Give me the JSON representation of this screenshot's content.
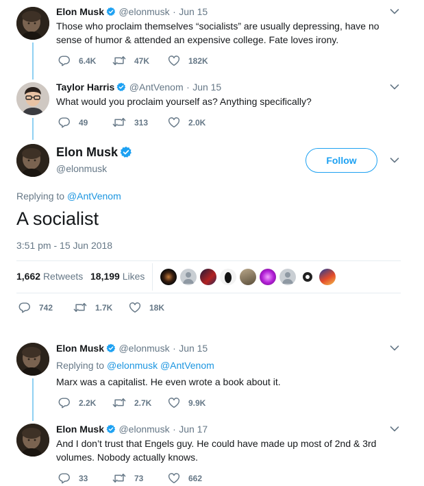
{
  "tweets_above": [
    {
      "name": "Elon Musk",
      "handle": "@elonmusk",
      "dot": "·",
      "date": "Jun 15",
      "text": "Those who proclaim themselves “socialists” are usually depressing, have no sense of humor & attended an expensive college. Fate loves irony.",
      "replies": "6.4K",
      "retweets": "47K",
      "likes": "182K"
    },
    {
      "name": "Taylor Harris",
      "handle": "@AntVenom",
      "dot": "·",
      "date": "Jun 15",
      "text": "What would you proclaim yourself as? Anything specifically?",
      "replies": "49",
      "retweets": "313",
      "likes": "2.0K"
    }
  ],
  "focused": {
    "name": "Elon Musk",
    "handle": "@elonmusk",
    "follow_label": "Follow",
    "replying_prefix": "Replying to",
    "replying_to": "@AntVenom",
    "text": "A socialist",
    "timestamp": "3:51 pm - 15 Jun 2018",
    "retweets_count": "1,662",
    "retweets_label": "Retweets",
    "likes_count": "18,199",
    "likes_label": "Likes",
    "replies": "742",
    "retweets": "1.7K",
    "likes": "18K"
  },
  "tweets_below": [
    {
      "name": "Elon Musk",
      "handle": "@elonmusk",
      "dot": "·",
      "date": "Jun 15",
      "replying_prefix": "Replying to",
      "replying_to_1": "@elonmusk",
      "replying_to_2": "@AntVenom",
      "text": "Marx was a capitalist. He even wrote a book about it.",
      "replies": "2.2K",
      "retweets": "2.7K",
      "likes": "9.9K"
    },
    {
      "name": "Elon Musk",
      "handle": "@elonmusk",
      "dot": "·",
      "date": "Jun 17",
      "text": "And I don’t trust that Engels guy. He could have made up most of 2nd & 3rd volumes. Nobody actually knows.",
      "replies": "33",
      "retweets": "73",
      "likes": "662"
    }
  ],
  "colors": {
    "accent": "#1da1f2",
    "link": "#1b95e0",
    "thread_line": "#8fd0f2",
    "muted": "#657786",
    "text": "#14171a",
    "divider": "#e6ecf0"
  },
  "icons": [
    "verified-icon",
    "chevron-down-icon",
    "reply-icon",
    "retweet-icon",
    "like-icon"
  ]
}
